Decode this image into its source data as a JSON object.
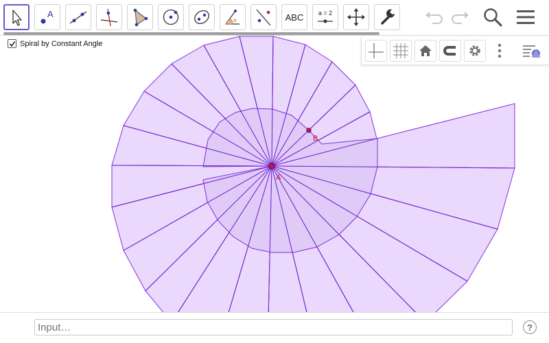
{
  "app": {
    "toolbar": {
      "text_tool_label": "ABC",
      "slider_tool_label_top": "a = 2",
      "selected_tool": "move"
    },
    "checkbox": {
      "label": "Spiral by Constant Angle",
      "checked": true
    },
    "points": {
      "a_label": "A",
      "b_label": "B"
    },
    "input": {
      "placeholder": "Input…"
    },
    "help_label": "?",
    "colors": {
      "accent": "#6557d2",
      "fill": "#e9d9fb",
      "stroke": "#8b2be3",
      "point": "#c41f1f"
    },
    "icons": [
      "move-tool-icon",
      "point-tool-icon",
      "line-tool-icon",
      "perpendicular-tool-icon",
      "polygon-tool-icon",
      "circle-tool-icon",
      "ellipse-tool-icon",
      "angle-tool-icon",
      "reflect-tool-icon",
      "slider-tool-icon",
      "move-graphics-tool-icon",
      "tools-wrench-icon",
      "undo-icon",
      "redo-icon",
      "search-icon",
      "menu-icon",
      "axes-icon",
      "grid-icon",
      "home-icon",
      "magnet-icon",
      "settings-gear-icon",
      "more-icon",
      "style-toggle-icon"
    ]
  }
}
